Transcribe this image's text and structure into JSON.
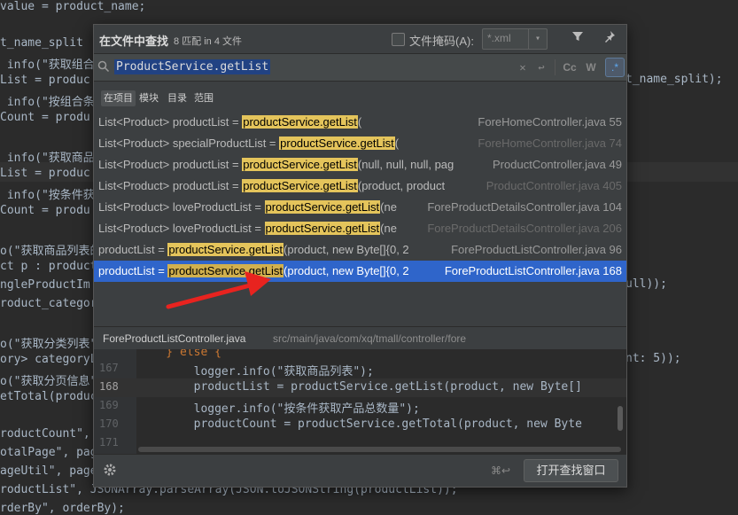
{
  "editor": {
    "lines": [
      {
        "text": "value = product_name;"
      },
      {
        "text": "t_name_split !"
      },
      {
        "text": " info(\"获取组合"
      },
      {
        "text": "List = produc"
      },
      {
        "text": " info(\"按组合条"
      },
      {
        "text": "Count = produ"
      },
      {
        "text": " info(\"获取商品"
      },
      {
        "text": "List = produc"
      },
      {
        "text": " info(\"按条件获"
      },
      {
        "text": "Count = produ"
      },
      {
        "text": "o(\"获取商品列表的"
      },
      {
        "text": "ct p : product"
      },
      {
        "text": "ngleProductIm"
      },
      {
        "text": "roduct_categor"
      },
      {
        "text": "o(\"获取分类列表\""
      },
      {
        "text": "ory> categoryL"
      },
      {
        "text": "o(\"获取分页信息\""
      },
      {
        "text": "etTotal(produc"
      },
      {
        "text": "roductCount\","
      },
      {
        "text": "otalPage\", pag"
      },
      {
        "text": "ageUtil\", page"
      },
      {
        "text": "roductList\", JSONArray.parseArray(JSON.toJSONString(productList));"
      },
      {
        "text": "rderBy\", orderBy);"
      }
    ],
    "right_lines": [
      {
        "text": "t_name_split);"
      },
      {
        "text": "ull));"
      },
      {
        "text": "nt: 5));"
      }
    ]
  },
  "popup": {
    "title": "在文件中查找",
    "match_count": "8 匹配 in 4 文件",
    "file_mask_label": "文件掩码(A):",
    "file_mask_value": "*.xml",
    "search_query": "ProductService.getList",
    "scope_tabs": [
      {
        "label": "在项目",
        "active": true
      },
      {
        "label": "模块",
        "active": false
      },
      {
        "label": "目录",
        "active": false
      },
      {
        "label": "范围",
        "active": false
      }
    ],
    "results": [
      {
        "prefix": "List<Product> productList = ",
        "match": "productService.getList",
        "suffix": "(",
        "file": "ForeHomeController.java 55",
        "dim": false,
        "selected": false
      },
      {
        "prefix": "List<Product> specialProductList = ",
        "match": "productService.getList",
        "suffix": "(",
        "file": "ForeHomeController.java 74",
        "dim": true,
        "selected": false
      },
      {
        "prefix": "List<Product> productList = ",
        "match": "productService.getList",
        "suffix": "(null, null, null, pag",
        "file": "ProductController.java 49",
        "dim": false,
        "selected": false
      },
      {
        "prefix": "List<Product> productList = ",
        "match": "productService.getList",
        "suffix": "(product, product",
        "file": "ProductController.java 405",
        "dim": true,
        "selected": false
      },
      {
        "prefix": "List<Product> loveProductList = ",
        "match": "productService.getList",
        "suffix": "(ne",
        "file": "ForeProductDetailsController.java 104",
        "dim": false,
        "selected": false
      },
      {
        "prefix": "List<Product> loveProductList = ",
        "match": "productService.getList",
        "suffix": "(ne",
        "file": "ForeProductDetailsController.java 206",
        "dim": true,
        "selected": false
      },
      {
        "prefix": "productList = ",
        "match": "productService.getList",
        "suffix": "(product, new Byte[]{0, 2",
        "file": "ForeProductListController.java 96",
        "dim": false,
        "selected": false
      },
      {
        "prefix": "productList = ",
        "match": "productService.getList",
        "suffix": "(product, new Byte[]{0, 2",
        "file": "ForeProductListController.java 168",
        "dim": false,
        "selected": true
      }
    ],
    "preview_file": "ForeProductListController.java",
    "preview_path": "src/main/java/com/xq/tmall/controller/fore",
    "preview_lines": [
      {
        "num": "167",
        "pre": "        logger.info(\"获取商品列表\");",
        "current": false
      },
      {
        "num": "168",
        "pre": "        productList = productService.getList(product, new Byte[]",
        "current": true
      },
      {
        "num": "169",
        "pre": "        logger.info(\"按条件获取产品总数量\");",
        "current": false
      },
      {
        "num": "170",
        "pre": "        productCount = productService.getTotal(product, new Byte",
        "current": false
      },
      {
        "num": "171",
        "pre": "",
        "current": false
      }
    ],
    "preview_above": "    } else {",
    "shortcut": "⌘↩",
    "open_button": "打开查找窗口"
  }
}
